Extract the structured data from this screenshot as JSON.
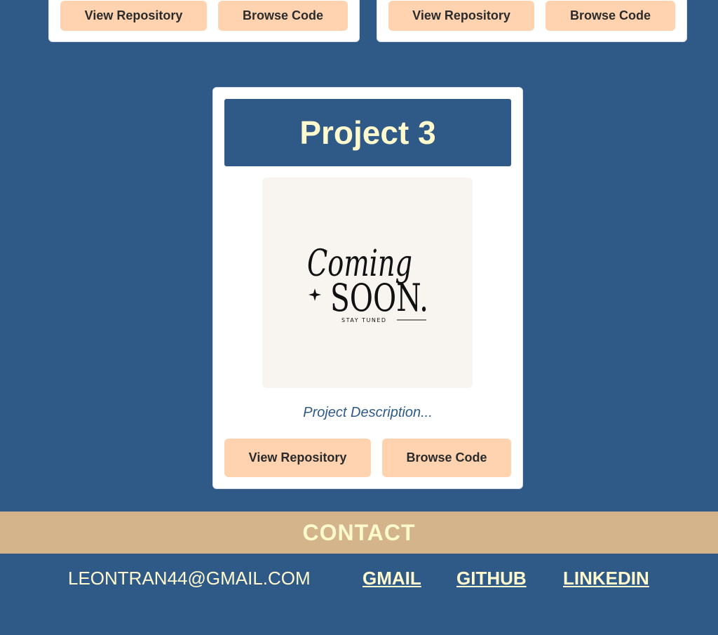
{
  "cards_top": [
    {
      "view_label": "View Repository",
      "browse_label": "Browse Code"
    },
    {
      "view_label": "View Repository",
      "browse_label": "Browse Code"
    }
  ],
  "project": {
    "title": "Project 3",
    "image_text": {
      "line1": "Coming",
      "line2": "SOON.",
      "tagline": "STAY TUNED"
    },
    "description": "Project Description...",
    "view_label": "View Repository",
    "browse_label": "Browse Code"
  },
  "contact": {
    "heading": "CONTACT",
    "email": "LEONTRAN44@GMAIL.COM",
    "links": [
      "GMAIL",
      "GITHUB",
      "LINKEDIN"
    ]
  },
  "colors": {
    "background": "#2f5a88",
    "card": "#ffffff",
    "button": "#ffd3b0",
    "contact_band": "#d3b48b",
    "accent_text": "#fffacd"
  }
}
